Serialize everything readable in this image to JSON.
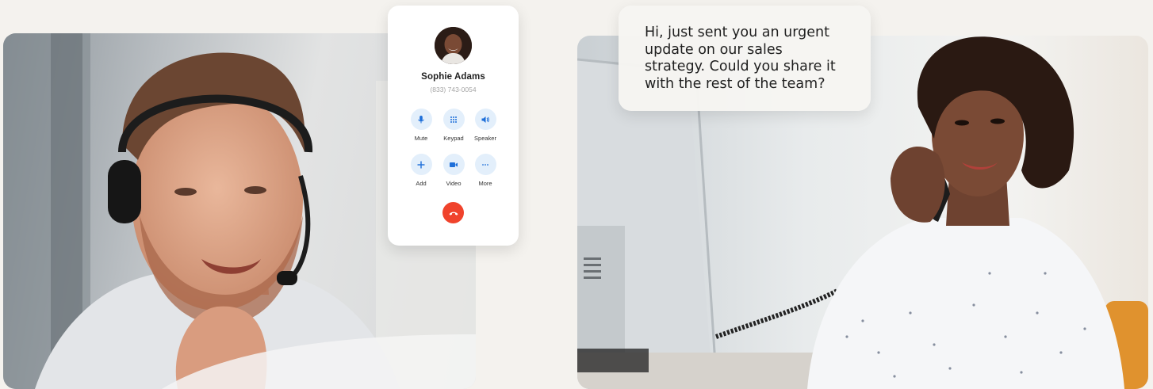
{
  "call_card": {
    "caller_name": "Sophie Adams",
    "caller_number": "(833) 743-0054",
    "controls": [
      {
        "label": "Mute",
        "icon": "microphone-icon"
      },
      {
        "label": "Keypad",
        "icon": "keypad-icon"
      },
      {
        "label": "Speaker",
        "icon": "speaker-icon"
      },
      {
        "label": "Add",
        "icon": "plus-icon"
      },
      {
        "label": "Video",
        "icon": "video-icon"
      },
      {
        "label": "More",
        "icon": "more-icon"
      }
    ],
    "hangup_icon": "hang-up-icon",
    "colors": {
      "button_bg": "#e3effb",
      "icon": "#1e6fd9",
      "hangup": "#f0432c"
    }
  },
  "message": {
    "text": "Hi, just sent you an urgent update on our sales strategy. Could you share it with the rest of the team?"
  }
}
